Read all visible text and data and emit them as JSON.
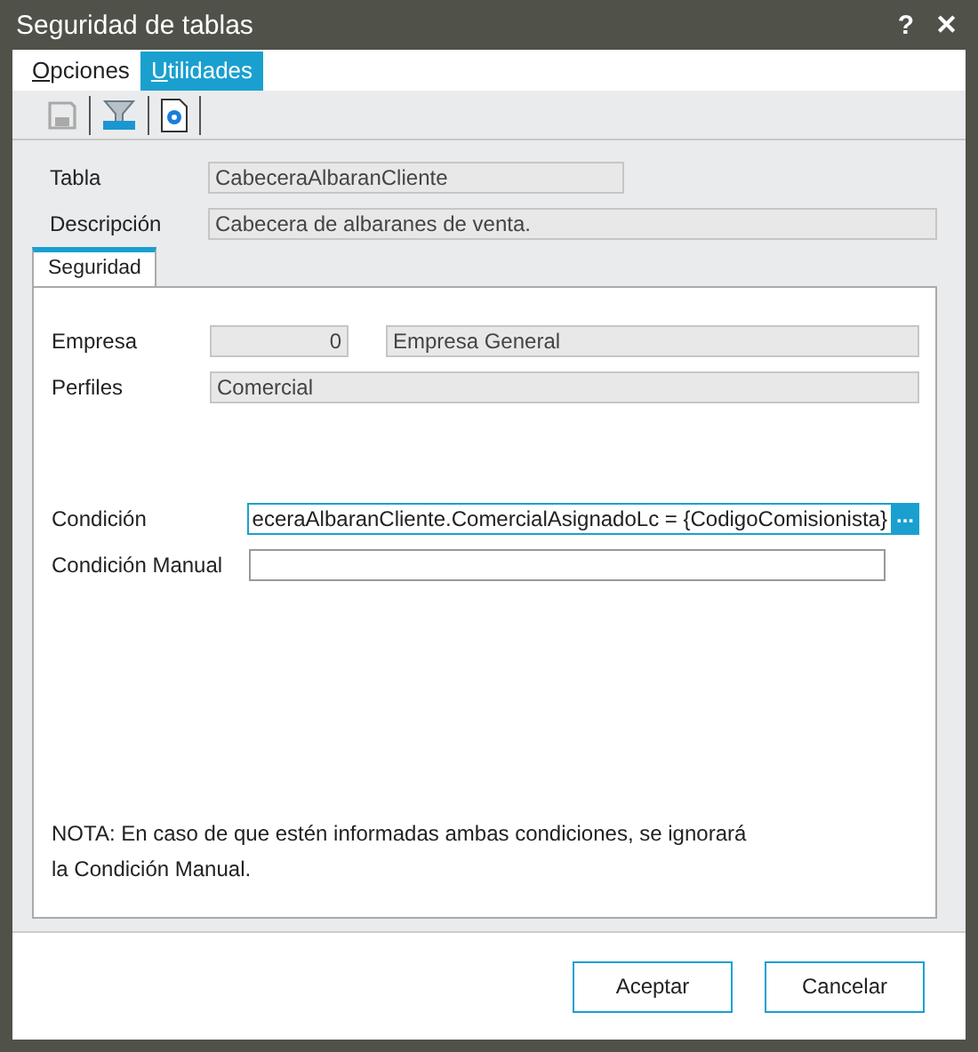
{
  "window": {
    "title": "Seguridad de tablas",
    "help": "?",
    "close": "✕"
  },
  "menu_tabs": [
    {
      "label": "Opciones",
      "selected": false
    },
    {
      "label": "Utilidades",
      "selected": true
    }
  ],
  "toolbar": [
    {
      "kind": "save",
      "disabled": true
    },
    {
      "kind": "filter"
    },
    {
      "kind": "settings"
    }
  ],
  "tabla": {
    "label": "Tabla",
    "value": "CabeceraAlbaranCliente"
  },
  "descripcion": {
    "label": "Descripción",
    "value": "Cabecera de albaranes de venta."
  },
  "tabs": [
    {
      "label": "Seguridad"
    }
  ],
  "empresa": {
    "label": "Empresa",
    "code": "0",
    "name": "Empresa General"
  },
  "perfiles": {
    "label": "Perfiles",
    "value": "Comercial"
  },
  "condicion": {
    "label": "Condición",
    "value": "eceraAlbaranCliente.ComercialAsignadoLc = {CodigoComisionista}",
    "button": "..."
  },
  "condicion_manual": {
    "label": "Condición Manual"
  },
  "note": [
    "NOTA: En caso de que estén informadas ambas condiciones, se ignorará",
    "la Condición Manual."
  ],
  "buttons": [
    "Aceptar",
    "Cancelar"
  ]
}
